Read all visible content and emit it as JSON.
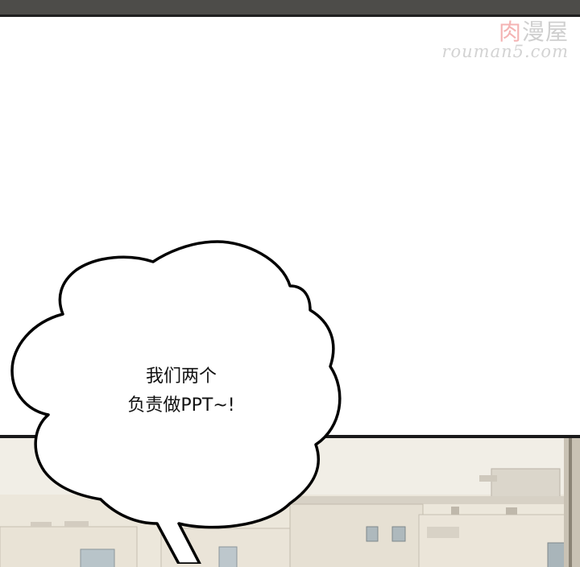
{
  "watermark": {
    "brand_accent": "肉",
    "brand_rest": "漫屋",
    "url": "rouman5.com"
  },
  "speech_bubble": {
    "line1": "我们两个",
    "line2": "负责做PPT~!"
  }
}
